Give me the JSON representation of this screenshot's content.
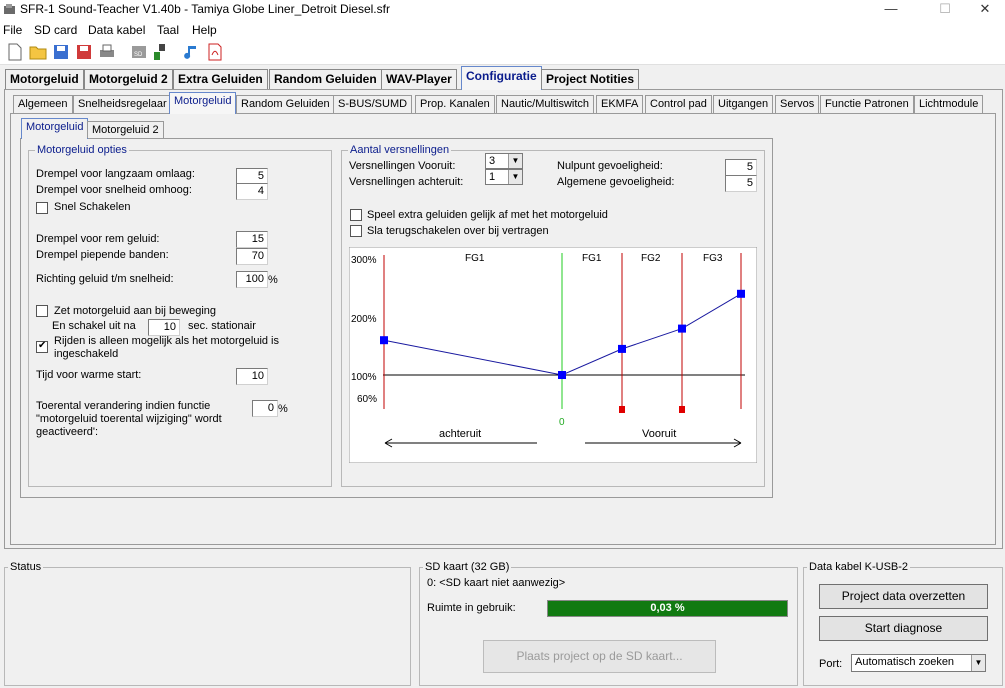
{
  "window": {
    "title": "SFR-1 Sound-Teacher V1.40b - Tamiya Globe Liner_Detroit Diesel.sfr",
    "minimize": "—",
    "maximize": "☐",
    "close": "✕"
  },
  "menu": [
    "File",
    "SD card",
    "Data kabel",
    "Taal",
    "Help"
  ],
  "toolbar": [
    "new-file-icon",
    "open-folder-icon",
    "save-icon",
    "save-red-icon",
    "print-icon",
    "sd-card-icon",
    "data-cable-icon",
    "music-note-icon",
    "pdf-icon"
  ],
  "main_tabs": [
    "Motorgeluid",
    "Motorgeluid 2",
    "Extra Geluiden",
    "Random Geluiden",
    "WAV-Player",
    "Configuratie",
    "Project Notities"
  ],
  "main_tab_active": "Configuratie",
  "sub_tabs": [
    "Algemeen",
    "Snelheidsregelaar",
    "Motorgeluid",
    "Random Geluiden",
    "S-BUS/SUMD",
    "Prop. Kanalen",
    "Nautic/Multiswitch",
    "EKMFA",
    "Control pad",
    "Uitgangen",
    "Servos",
    "Functie Patronen",
    "Lichtmodule"
  ],
  "sub_tab_active": "Motorgeluid",
  "third_tabs": [
    "Motorgeluid",
    "Motorgeluid 2"
  ],
  "opties": {
    "legend": "Motorgeluid opties",
    "drempel_langzaam_label": "Drempel voor langzaam omlaag:",
    "drempel_langzaam": "5",
    "drempel_snelheid_label": "Drempel voor snelheid omhoog:",
    "drempel_snelheid": "4",
    "snel_schakelen_label": "Snel Schakelen",
    "snel_schakelen": false,
    "rem_label": "Drempel voor rem geluid:",
    "rem": "15",
    "piepende_label": "Drempel piepende banden:",
    "piepende": "70",
    "richting_label": "Richting geluid t/m snelheid:",
    "richting": "100",
    "percent": "%",
    "zet_aan_label": "Zet motorgeluid aan bij beweging",
    "zet_aan": false,
    "schakel_uit_label": "En schakel uit na",
    "schakel_uit": "10",
    "sec_label": "sec. stationair",
    "rijden_label_1": "Rijden is alleen mogelijk als het motorgeluid is",
    "rijden_label_2": "ingeschakeld",
    "rijden": true,
    "warme_label": "Tijd voor warme start:",
    "warme": "10",
    "toerental_label_1": "Toerental verandering indien functie",
    "toerental_label_2": "\"motorgeluid toerental wijziging\" wordt",
    "toerental_label_3": "geactiveerd':",
    "toerental": "0"
  },
  "versnellingen": {
    "legend": "Aantal versnellingen",
    "vooruit_label": "Versnellingen Vooruit:",
    "vooruit": "3",
    "achteruit_label": "Versnellingen achteruit:",
    "achteruit": "1",
    "nulpunt_label": "Nulpunt gevoeligheid:",
    "nulpunt": "5",
    "algemeen_label": "Algemene gevoeligheid:",
    "algemeen": "5",
    "speel_label": "Speel extra geluiden gelijk af met het motorgeluid",
    "speel": false,
    "sla_label": "Sla terugschakelen over bij vertragen",
    "sla": false
  },
  "graph": {
    "y_labels": [
      "300%",
      "200%",
      "100%",
      "60%"
    ],
    "gear_labels": [
      "FG1",
      "FG1",
      "FG2",
      "FG3"
    ],
    "zero_label": "0",
    "achteruit": "achteruit",
    "vooruit": "Vooruit",
    "points_pct": [
      160,
      100,
      145,
      180,
      240
    ],
    "line_color": "#1a1aa0",
    "marker_color": "#0000ff",
    "red_color": "#cc0000",
    "green_color": "#22cc22"
  },
  "status": {
    "legend": "Status"
  },
  "sd": {
    "legend": "SD kaart (32 GB)",
    "line": "0: <SD kaart niet aanwezig>",
    "ruimte_label": "Ruimte in gebruik:",
    "ruimte": "0,03 %",
    "ruimte_fraction": 0.0003,
    "plaats_button": "Plaats project op de SD kaart..."
  },
  "kabel": {
    "legend": "Data kabel K-USB-2",
    "overzetten": "Project data overzetten",
    "diagnose": "Start diagnose",
    "port_label": "Port:",
    "port": "Automatisch zoeken"
  }
}
